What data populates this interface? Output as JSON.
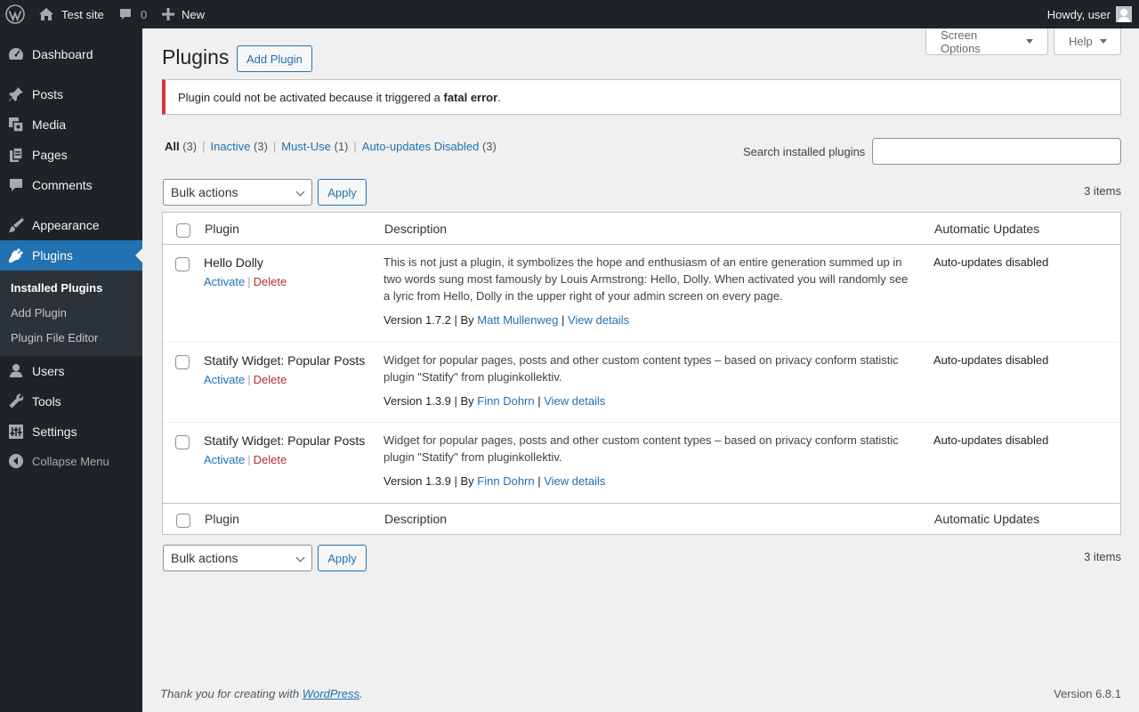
{
  "adminbar": {
    "site_name": "Test site",
    "comments_count": "0",
    "new_label": "New",
    "howdy": "Howdy, user"
  },
  "sidebar": {
    "items": [
      {
        "label": "Dashboard",
        "icon": "dashboard-icon"
      },
      {
        "label": "Posts",
        "icon": "pushpin-icon"
      },
      {
        "label": "Media",
        "icon": "media-icon"
      },
      {
        "label": "Pages",
        "icon": "pages-icon"
      },
      {
        "label": "Comments",
        "icon": "comment-icon"
      },
      {
        "label": "Appearance",
        "icon": "paintbrush-icon"
      },
      {
        "label": "Plugins",
        "icon": "plugin-icon"
      },
      {
        "label": "Users",
        "icon": "users-icon"
      },
      {
        "label": "Tools",
        "icon": "wrench-icon"
      },
      {
        "label": "Settings",
        "icon": "settings-icon"
      }
    ],
    "submenu": [
      "Installed Plugins",
      "Add Plugin",
      "Plugin File Editor"
    ],
    "collapse_label": "Collapse Menu"
  },
  "screen_meta": {
    "screen_options": "Screen Options",
    "help": "Help"
  },
  "page": {
    "title": "Plugins",
    "add_button": "Add Plugin"
  },
  "notice": {
    "text_before": "Plugin could not be activated because it triggered a ",
    "strong": "fatal error",
    "text_after": "."
  },
  "filters": [
    {
      "label": "All",
      "count": "(3)"
    },
    {
      "label": "Inactive",
      "count": "(3)"
    },
    {
      "label": "Must-Use",
      "count": "(1)"
    },
    {
      "label": "Auto-updates Disabled",
      "count": "(3)"
    }
  ],
  "search": {
    "label": "Search installed plugins",
    "value": ""
  },
  "bulk": {
    "selected": "Bulk actions",
    "apply": "Apply",
    "items_count": "3 items"
  },
  "table": {
    "columns": [
      "Plugin",
      "Description",
      "Automatic Updates"
    ],
    "rows": [
      {
        "name": "Hello Dolly",
        "activate": "Activate",
        "delete": "Delete",
        "description": "This is not just a plugin, it symbolizes the hope and enthusiasm of an entire generation summed up in two words sung most famously by Louis Armstrong: Hello, Dolly. When activated you will randomly see a lyric from Hello, Dolly in the upper right of your admin screen on every page.",
        "version": "Version 1.7.2",
        "by": "By",
        "author": "Matt Mullenweg",
        "details": "View details",
        "auto_updates": "Auto-updates disabled"
      },
      {
        "name": "Statify Widget: Popular Posts",
        "activate": "Activate",
        "delete": "Delete",
        "description": "Widget for popular pages, posts and other custom content types – based on privacy conform statistic plugin \"Statify\" from pluginkollektiv.",
        "version": "Version 1.3.9",
        "by": "By",
        "author": "Finn Dohrn",
        "details": "View details",
        "auto_updates": "Auto-updates disabled"
      },
      {
        "name": "Statify Widget: Popular Posts",
        "activate": "Activate",
        "delete": "Delete",
        "description": "Widget for popular pages, posts and other custom content types – based on privacy conform statistic plugin \"Statify\" from pluginkollektiv.",
        "version": "Version 1.3.9",
        "by": "By",
        "author": "Finn Dohrn",
        "details": "View details",
        "auto_updates": "Auto-updates disabled"
      }
    ]
  },
  "footer": {
    "thanks_before": "Thank you for creating with ",
    "thanks_link": "WordPress",
    "thanks_after": ".",
    "version": "Version 6.8.1"
  },
  "colors": {
    "accent": "#2271b1",
    "adminbar_bg": "#1d2327",
    "error": "#d63638",
    "delete": "#b32d2e"
  }
}
